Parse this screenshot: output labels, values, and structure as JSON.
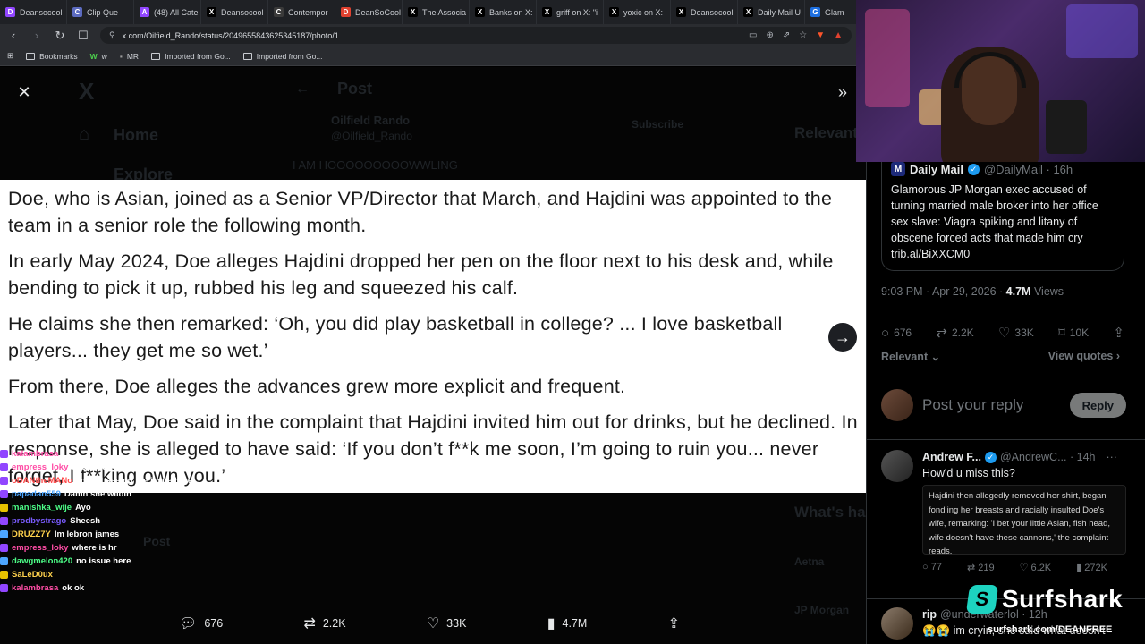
{
  "browser": {
    "tabs": [
      {
        "label": "Deansocool",
        "color": "#9146ff",
        "glyph": "D"
      },
      {
        "label": "Clip Que",
        "color": "#5c6bc0",
        "glyph": "C"
      },
      {
        "label": "(48) All Cate",
        "color": "#9146ff",
        "glyph": "A"
      },
      {
        "label": "Deansocool",
        "color": "#000000",
        "glyph": "X"
      },
      {
        "label": "Contempor",
        "color": "#3a3a3a",
        "glyph": "C"
      },
      {
        "label": "DeanSoCool",
        "color": "#e0412f",
        "glyph": "D"
      },
      {
        "label": "The Associa",
        "color": "#000000",
        "glyph": "X"
      },
      {
        "label": "Banks on X:",
        "color": "#000000",
        "glyph": "X"
      },
      {
        "label": "griff on X: \"i",
        "color": "#000000",
        "glyph": "X"
      },
      {
        "label": "yoxic on X:",
        "color": "#000000",
        "glyph": "X"
      },
      {
        "label": "Deansocool",
        "color": "#000000",
        "glyph": "X"
      },
      {
        "label": "Daily Mail U",
        "color": "#000000",
        "glyph": "X"
      },
      {
        "label": "Glam",
        "color": "#1d6fe0",
        "glyph": "G"
      }
    ],
    "url": "x.com/Oilfield_Rando/status/2049655843625345187/photo/1",
    "bookmarks": [
      {
        "label": "Bookmarks"
      },
      {
        "label": "w"
      },
      {
        "label": "MR"
      },
      {
        "label": "Imported from Go..."
      },
      {
        "label": "Imported from Go..."
      }
    ]
  },
  "background_page": {
    "header_title": "Post",
    "nav_home": "Home",
    "nav_explore": "Explore",
    "author_name": "Oilfield Rando",
    "author_handle": "@Oilfield_Rando",
    "subscribe_label": "Subscribe",
    "post_text": "I AM HOOOOOOOOOWWLING",
    "sidebar_relevant": "Relevant",
    "sidebar_whats_happening": "What's ha",
    "trend_1": "Aetna",
    "trend_2": "JP Morgan",
    "post_button": "Post"
  },
  "article": {
    "paragraphs": [
      "Doe, who is Asian, joined as a Senior VP/Director that March, and Hajdini was appointed to the team in a senior role the following month.",
      "In early May 2024, Doe alleges Hajdini dropped her pen on the floor next to his desk and, while bending to pick it up, rubbed his leg and squeezed his calf.",
      "He claims she then remarked: ‘Oh, you did play basketball in college? ... I love basketball players... they get me so wet.’",
      "From there, Doe alleges the advances grew more explicit and frequent.",
      "Later that May, Doe said in the complaint that Hajdini invited him out for drinks, but he declined. In response, she is alleged to have said: ‘If you don’t f**k me soon, I’m going to ruin you... never forget, I f**king own you.’"
    ]
  },
  "actions": {
    "replies": "676",
    "reposts": "2.2K",
    "likes": "33K",
    "views": "4.7M"
  },
  "chat": [
    {
      "user": "kalambrasa",
      "msg": "",
      "color": "#ff4da6",
      "badge": "#9146ff"
    },
    {
      "user": "empress_loky",
      "msg": "ayooooooo",
      "color": "#ff4da6",
      "badge": "#9146ff"
    },
    {
      "user": "oDANtheMANo",
      "msg": "I'm not seeing the issue here",
      "color": "#ff4d4d",
      "badge": "#9146ff"
    },
    {
      "user": "papadan559",
      "msg": "Damn she wildin",
      "color": "#4da6ff",
      "badge": "#9146ff"
    },
    {
      "user": "manishka_wije",
      "msg": "Ayo",
      "color": "#4dff88",
      "badge": "#e6c200"
    },
    {
      "user": "prodbystrago",
      "msg": "Sheesh",
      "color": "#7a5cff",
      "badge": "#9146ff"
    },
    {
      "user": "DRUZZ7Y",
      "msg": "Im lebron james",
      "color": "#ffd24d",
      "badge": "#4da6ff"
    },
    {
      "user": "empress_loky",
      "msg": "where is hr",
      "color": "#ff4da6",
      "badge": "#9146ff"
    },
    {
      "user": "dawgmelon420",
      "msg": "no issue here",
      "color": "#4dff88",
      "badge": "#4da6ff"
    },
    {
      "user": "SaLeD0ux",
      "msg": "",
      "color": "#ffd24d",
      "badge": "#e6c200"
    },
    {
      "user": "kalambrasa",
      "msg": "ok ok",
      "color": "#ff4da6",
      "badge": "#9146ff"
    }
  ],
  "tweet": {
    "quote": {
      "source": "Daily Mail",
      "handle": "@DailyMail · 16h",
      "text": "Glamorous JP Morgan exec accused of turning married male broker into her office sex slave: Viagra spiking and litany of obscene forced acts that made him cry trib.al/BiXXCM0"
    },
    "timestamp": "9:03 PM · Apr 29, 2026 · ",
    "views_count": "4.7M",
    "views_label": " Views",
    "stats": {
      "replies": "676",
      "reposts": "2.2K",
      "likes": "33K",
      "bookmarks": "10K"
    },
    "relevant_label": "Relevant",
    "view_quotes_label": "View quotes",
    "reply_placeholder": "Post your reply",
    "reply_button": "Reply"
  },
  "replies": [
    {
      "name": "Andrew F...",
      "handle": "@AndrewC... · 14h",
      "text": "How'd u miss this?",
      "image_text": "Hajdini then allegedly removed her shirt, began fondling her breasts and racially insulted Doe's wife, remarking: 'I bet your little Asian, fish head, wife doesn't have these cannons,' the complaint reads.",
      "stats": {
        "replies": "77",
        "reposts": "219",
        "likes": "6.2K",
        "views": "272K"
      }
    },
    {
      "name": "rip",
      "handle": "@underwaterlol · 12h",
      "text": "😭😭 im cryin, she said what doesn't"
    }
  ],
  "sponsor": {
    "name": "Surfshark",
    "url": "surfshark.com/DEANFREE"
  }
}
